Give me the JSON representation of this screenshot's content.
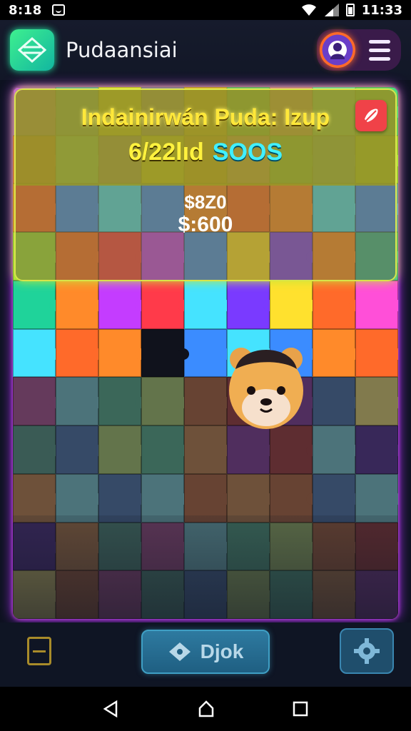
{
  "status_bar": {
    "time_left": "8:18",
    "time_right": "11:33"
  },
  "header": {
    "title": "Pudaansiai"
  },
  "info_panel": {
    "title": "Indainirwán Puda: Izup",
    "date": "6/22lıd",
    "code": "SOOS",
    "price_1": "$8Z0",
    "price_2": "$:600"
  },
  "toolbar": {
    "ok_label": "Djok"
  },
  "colors": {
    "accent": "#b033ff",
    "panel": "#96942a",
    "button": "#2e7aa0"
  },
  "icons": [
    "app-logo-icon",
    "avatar-icon",
    "menu-icon",
    "close-icon",
    "note-icon",
    "diamond-icon",
    "gear-icon",
    "back-icon",
    "home-icon",
    "recents-icon"
  ]
}
